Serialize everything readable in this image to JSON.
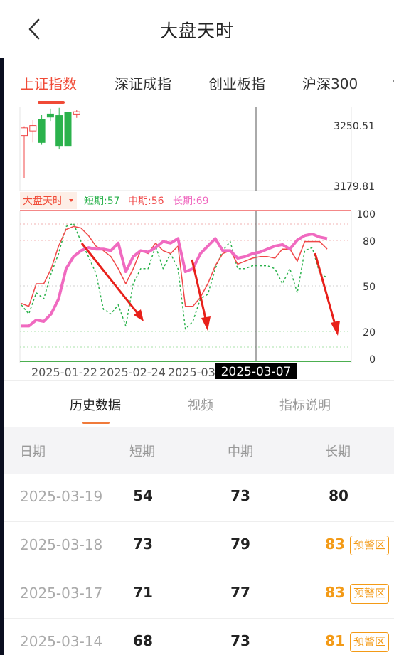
{
  "header": {
    "title": "大盘天时"
  },
  "tabs": [
    {
      "label": "上证指数",
      "active": true
    },
    {
      "label": "深证成指",
      "active": false
    },
    {
      "label": "创业板指",
      "active": false
    },
    {
      "label": "沪深300",
      "active": false
    }
  ],
  "kline": {
    "price_upper": "3250.51",
    "price_lower": "3179.81"
  },
  "indicator": {
    "name": "大盘天时",
    "short_label": "短期:57",
    "mid_label": "中期:56",
    "long_label": "长期:69",
    "colors": {
      "short": "#2bb24c",
      "mid": "#f04848",
      "long": "#f06ac0",
      "up": "#f04848",
      "down": "#2bb24c"
    }
  },
  "chart_data": {
    "type": "line",
    "y_ticks": [
      "100",
      "80",
      "50",
      "20",
      "0"
    ],
    "ylim": [
      0,
      100
    ],
    "x_ticks": [
      "2025-01-22",
      "2025-02-24",
      "2025-03"
    ],
    "crosshair_label": "2025-03-07",
    "crosshair_index": 31,
    "series": [
      {
        "name": "短期",
        "values": [
          36,
          30,
          44,
          40,
          57,
          70,
          88,
          90,
          78,
          68,
          57,
          33,
          30,
          36,
          22,
          50,
          60,
          60,
          75,
          60,
          70,
          60,
          20,
          25,
          40,
          43,
          60,
          72,
          78,
          60,
          60,
          62,
          62,
          62,
          60,
          50,
          60,
          44,
          72,
          74,
          57,
          54
        ]
      },
      {
        "name": "中期",
        "values": [
          37,
          35,
          50,
          50,
          60,
          75,
          86,
          88,
          87,
          82,
          75,
          72,
          68,
          60,
          50,
          60,
          72,
          70,
          77,
          72,
          70,
          75,
          35,
          35,
          41,
          50,
          62,
          70,
          72,
          63,
          65,
          67,
          68,
          68,
          67,
          73,
          73,
          65,
          78,
          78,
          78,
          73
        ]
      },
      {
        "name": "长期",
        "values": [
          22,
          22,
          26,
          25,
          30,
          40,
          60,
          68,
          72,
          74,
          73,
          73,
          72,
          77,
          58,
          68,
          72,
          71,
          74,
          78,
          77,
          80,
          58,
          60,
          70,
          75,
          80,
          72,
          72,
          67,
          68,
          70,
          71,
          73,
          75,
          76,
          73,
          79,
          82,
          83,
          81,
          80
        ]
      }
    ],
    "candles": [
      {
        "open": 3235,
        "close": 3245,
        "high": 3247,
        "low": 3180
      },
      {
        "open": 3241,
        "close": 3248,
        "high": 3255,
        "low": 3226
      },
      {
        "open": 3256,
        "close": 3226,
        "high": 3262,
        "low": 3223
      },
      {
        "open": 3263,
        "close": 3259,
        "high": 3270,
        "low": 3254
      },
      {
        "open": 3261,
        "close": 3222,
        "high": 3271,
        "low": 3217
      },
      {
        "open": 3265,
        "close": 3222,
        "high": 3275,
        "low": 3220
      },
      {
        "open": 3263,
        "close": 3266,
        "high": 3268,
        "low": 3258
      }
    ],
    "candle_range": [
      3163.34,
      3272.63
    ]
  },
  "history": {
    "subtabs": [
      {
        "label": "历史数据",
        "active": true
      },
      {
        "label": "视频",
        "active": false
      },
      {
        "label": "指标说明",
        "active": false
      }
    ],
    "headers": {
      "date": "日期",
      "short": "短期",
      "mid": "中期",
      "long": "长期"
    },
    "rows": [
      {
        "date": "2025-03-19",
        "short": "54",
        "mid": "73",
        "long": "80",
        "badge": ""
      },
      {
        "date": "2025-03-18",
        "short": "73",
        "mid": "79",
        "long": "83",
        "badge": "预警区"
      },
      {
        "date": "2025-03-17",
        "short": "71",
        "mid": "77",
        "long": "83",
        "badge": "预警区"
      },
      {
        "date": "2025-03-14",
        "short": "68",
        "mid": "73",
        "long": "81",
        "badge": "预警区"
      }
    ]
  }
}
